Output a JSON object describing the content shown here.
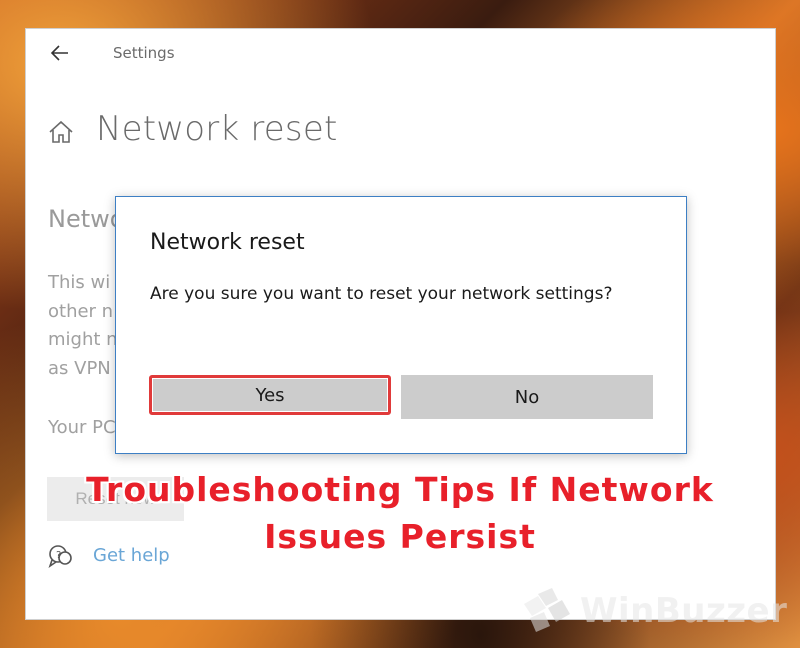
{
  "window": {
    "title": "Settings",
    "page_title": "Network reset",
    "section_heading": "Netwo",
    "description_lines": [
      "This wi",
      "other n",
      "might n",
      "as VPN"
    ],
    "pc_text": "Your PC",
    "reset_button_label": "Reset now",
    "help_link": "Get help"
  },
  "dialog": {
    "title": "Network reset",
    "message": "Are you sure you want to reset your network settings?",
    "yes_label": "Yes",
    "no_label": "No",
    "highlight_color": "#e03a3a"
  },
  "overlay": {
    "headline_line1": "Troubleshooting Tips If Network",
    "headline_line2": "Issues Persist",
    "color": "#e8202a"
  },
  "watermark": {
    "text": "WinBuzzer"
  },
  "icons": {
    "back": "back-arrow-icon",
    "home": "home-icon",
    "help": "help-chat-icon",
    "logo": "winbuzzer-logo-icon"
  }
}
